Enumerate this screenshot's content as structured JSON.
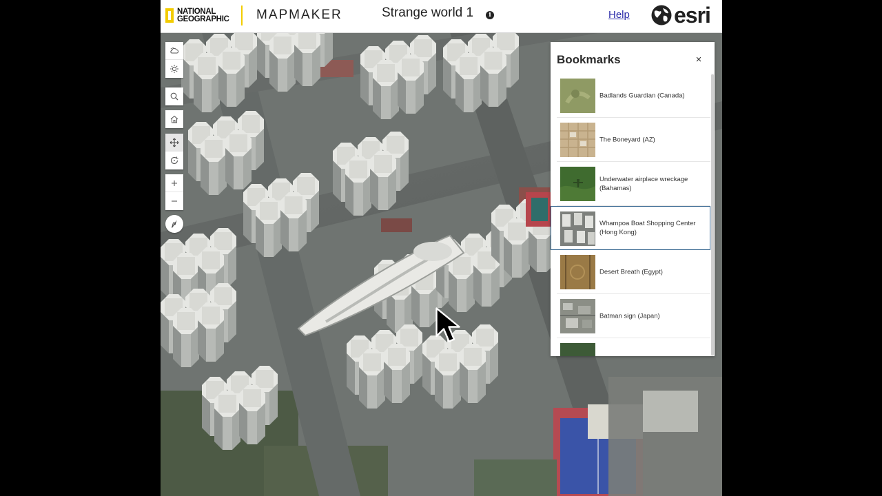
{
  "header": {
    "brand_line1": "NATIONAL",
    "brand_line2": "GEOGRAPHIC",
    "app_name": "MAPMAKER",
    "map_title": "Strange world 1",
    "info_glyph": "i",
    "help_label": "Help",
    "vendor_name": "esri"
  },
  "toolbar": {
    "tools": [
      "weather-icon",
      "daylight-icon",
      "search-icon",
      "home-icon",
      "pan-icon",
      "rotate-icon",
      "zoom-in-icon",
      "zoom-out-icon",
      "compass-icon"
    ],
    "active_tool": "pan-icon"
  },
  "bookmarks": {
    "title": "Bookmarks",
    "close_glyph": "×",
    "items": [
      {
        "label": "Badlands Guardian (Canada)"
      },
      {
        "label": "The Boneyard (AZ)"
      },
      {
        "label": "Underwater airplace wreckage (Bahamas)"
      },
      {
        "label": "Whampoa Boat Shopping Center (Hong Kong)",
        "selected": true
      },
      {
        "label": "Desert Breath (Egypt)"
      },
      {
        "label": "Batman sign (Japan)"
      }
    ]
  },
  "colors": {
    "brand_yellow": "#f3cc00",
    "selection_border": "#2d5f8b",
    "link": "#2a2aa8"
  }
}
